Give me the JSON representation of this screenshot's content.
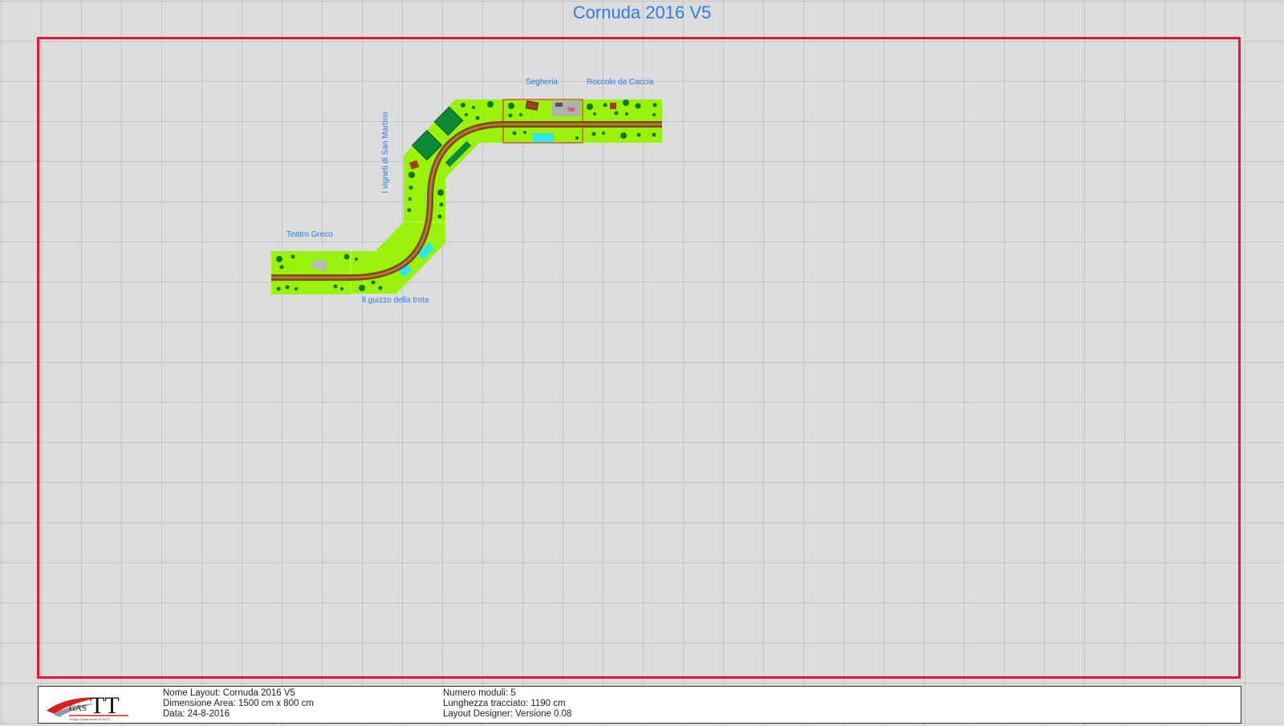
{
  "title": "Cornuda 2016 V5",
  "modules": [
    {
      "label": "Teatro Greco"
    },
    {
      "label": "Il guizzo della trota"
    },
    {
      "label": "I vigneti di San Martino"
    },
    {
      "label": "Segheria"
    },
    {
      "label": "Roccolo da Caccia"
    }
  ],
  "info": {
    "col1": [
      "Nome Layout: Cornuda 2016 V5",
      "Dimensione Area: 1500 cm x 800 cm",
      "Data: 24-8-2016"
    ],
    "col2": [
      "Numero moduli: 5",
      "Lunghezza tracciato: 1190 cm",
      "Layout Designer: Versione 0.08"
    ]
  },
  "logo": {
    "text": "TT",
    "prefix": "GAS",
    "tagline": "Gruppo Appassionati Scala TT"
  },
  "colors": {
    "border": "#e0153c",
    "title": "#2a7ce8",
    "grass": "#9af20a",
    "tree": "#0b7a1a",
    "track": "#a0642a",
    "water": "#28e8ec",
    "building": "#a0401e"
  }
}
